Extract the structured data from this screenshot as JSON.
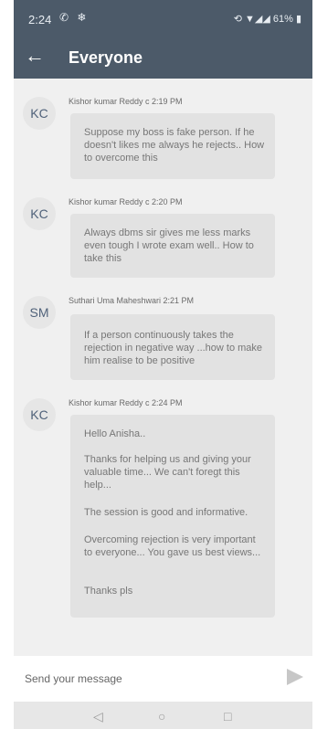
{
  "status": {
    "time": "2:24",
    "left_icons": "✆ ❄",
    "right": "⟲ ▼◢◢ 61% ▮"
  },
  "appbar": {
    "back_icon": "arrow-back",
    "title": "Everyone"
  },
  "messages": [
    {
      "initials": "KC",
      "meta": "Kishor kumar Reddy c 2:19 PM",
      "text": "Suppose my boss is fake person. If he doesn't likes me always he rejects.. How to overcome this"
    },
    {
      "initials": "KC",
      "meta": "Kishor kumar Reddy c 2:20 PM",
      "text": "Always dbms sir gives me less marks even tough I wrote exam well.. How to take this"
    },
    {
      "initials": "SM",
      "meta": "Suthari Uma Maheshwari 2:21 PM",
      "text": "If a person continuously takes the rejection in negative way ...how to make him realise to be positive"
    },
    {
      "initials": "KC",
      "meta": "Kishor kumar Reddy c 2:24 PM",
      "p1": "Hello Anisha..",
      "p2": "Thanks for helping us and giving your valuable time... We can't foregt this help...",
      "p3": "The session is good and informative.",
      "p4": "Overcoming rejection is very important to everyone... You gave us best views...",
      "p5": "Thanks pls"
    }
  ],
  "composer": {
    "placeholder": "Send your message",
    "send_icon": "send-arrow"
  },
  "navbar": {
    "back": "◁",
    "home": "○",
    "recents": "□"
  }
}
